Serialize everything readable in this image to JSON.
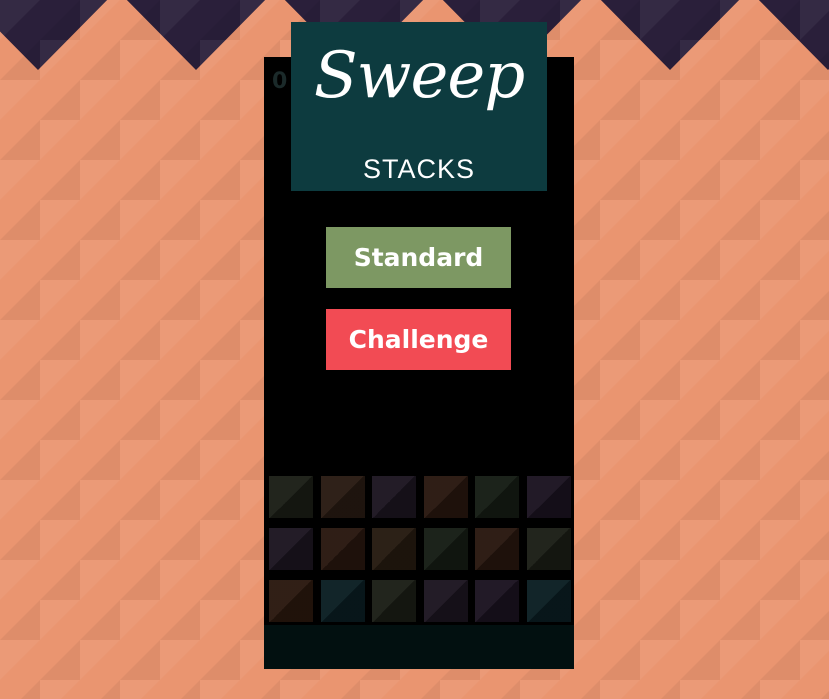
{
  "logo": {
    "title": "Sweep",
    "subtitle": "STACKS"
  },
  "score_peek": "0",
  "menu": {
    "standard_label": "Standard",
    "challenge_label": "Challenge"
  },
  "colors": {
    "panel": "#000000",
    "logo_bg": "#0d3b3f",
    "standard": "#7d9863",
    "challenge": "#f24b54",
    "bg_bands": [
      "#ea9570",
      "#eec66c",
      "#f1d68b",
      "#8aa56b",
      "#3f7466",
      "#103f48",
      "#271c37"
    ]
  },
  "board": {
    "rows": [
      [
        "#1b1e16",
        "#281a12",
        "#1c1520",
        "#28170f",
        "#151c14",
        "#1b1320"
      ],
      [
        "#1c1520",
        "#28170f",
        "#251a10",
        "#151c14",
        "#28170f",
        "#1b1e16"
      ],
      [
        "#2a180e",
        "#0a1e22",
        "#1b1e16",
        "#1c1520",
        "#1b1320",
        "#0a1e22"
      ]
    ]
  }
}
